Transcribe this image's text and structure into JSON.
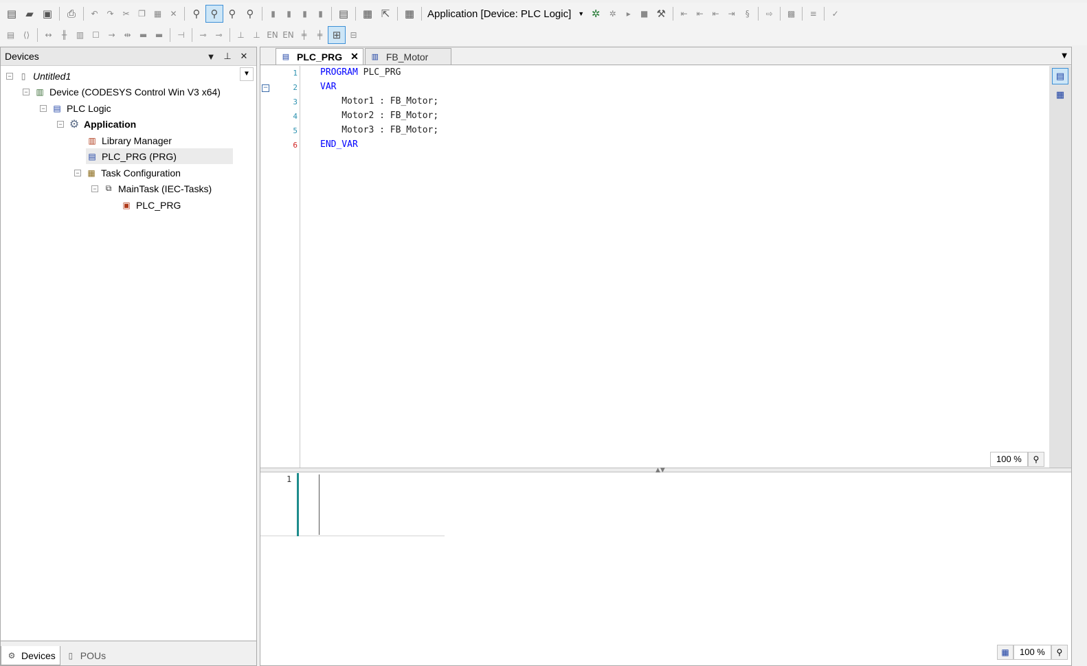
{
  "toolbar1": {
    "active_application": "Application [Device: PLC Logic]",
    "icons": [
      "new-file-icon",
      "open-icon",
      "save-icon",
      "print-icon",
      "undo-icon",
      "redo-icon",
      "cut-icon",
      "copy-icon",
      "paste-icon",
      "delete-icon",
      "find-icon",
      "find-next-icon",
      "replace-icon",
      "replace-next-icon",
      "bookmark-icon",
      "bookmark-prev-icon",
      "bookmark-next-icon",
      "bookmark-clear-icon",
      "clipboard-icon",
      "insert-icon",
      "export-icon",
      "cross-reference-icon",
      "login-icon",
      "logout-icon",
      "run-icon",
      "stop-icon",
      "tools-icon",
      "step-over-icon",
      "step-into-icon",
      "step-out-icon",
      "run-to-cursor-icon",
      "set-next-icon",
      "show-next-icon",
      "write-values-icon",
      "filter-icon",
      "check-icon"
    ]
  },
  "devices_panel": {
    "title": "Devices",
    "tree": [
      {
        "label": "Untitled1",
        "icon": "project-icon"
      },
      {
        "label": "Device (CODESYS Control Win V3 x64)",
        "icon": "device-icon"
      },
      {
        "label": "PLC Logic",
        "icon": "plc-logic-icon"
      },
      {
        "label": "Application",
        "icon": "application-gear-icon"
      },
      {
        "label": "Library Manager",
        "icon": "library-books-icon"
      },
      {
        "label": "PLC_PRG (PRG)",
        "icon": "program-icon"
      },
      {
        "label": "Task Configuration",
        "icon": "task-config-icon"
      },
      {
        "label": "MainTask (IEC-Tasks)",
        "icon": "task-icon"
      },
      {
        "label": "PLC_PRG",
        "icon": "program-call-icon"
      }
    ],
    "bottom_tabs": [
      {
        "label": "Devices",
        "icon": "devices-icon"
      },
      {
        "label": "POUs",
        "icon": "pous-icon"
      }
    ]
  },
  "editor": {
    "tabs": [
      {
        "label": "PLC_PRG",
        "active": true
      },
      {
        "label": "FB_Motor",
        "active": false
      }
    ],
    "declaration": {
      "line_numbers": [
        "1",
        "2",
        "3",
        "4",
        "5",
        "6"
      ],
      "lines": [
        {
          "kw": "PROGRAM",
          "rest": " PLC_PRG"
        },
        {
          "kw": "VAR",
          "rest": ""
        },
        {
          "kw": "",
          "rest": "    Motor1 : FB_Motor;"
        },
        {
          "kw": "",
          "rest": "    Motor2 : FB_Motor;"
        },
        {
          "kw": "",
          "rest": "    Motor3 : FB_Motor;"
        },
        {
          "kw": "END_VAR",
          "rest": ""
        }
      ],
      "zoom": "100 %"
    },
    "implementation": {
      "network_number": "1",
      "zoom": "100 %"
    }
  }
}
